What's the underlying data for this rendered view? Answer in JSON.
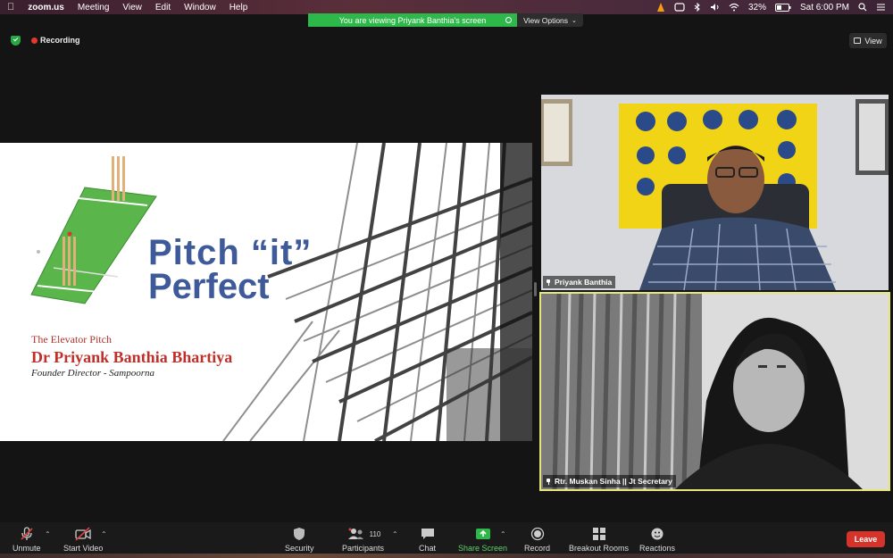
{
  "menubar": {
    "app_name": "zoom.us",
    "items": [
      "Meeting",
      "View",
      "Edit",
      "Window",
      "Help"
    ],
    "battery": "32%",
    "clock": "Sat 6:00 PM"
  },
  "share_banner": {
    "text": "You are viewing Priyank Banthia's screen",
    "view_options_label": "View Options"
  },
  "status": {
    "recording_label": "Recording",
    "view_label": "View"
  },
  "slide": {
    "title_line1": "Pitch “it”",
    "title_line2": "Perfect",
    "subtitle": "The Elevator Pitch",
    "presenter_name": "Dr Priyank Banthia Bhartiya",
    "presenter_role": "Founder Director - Sampoorna"
  },
  "participants_video": [
    {
      "name": "Priyank Banthia"
    },
    {
      "name": "Rtr. Muskan Sinha || Jt Secretary"
    }
  ],
  "toolbar": {
    "unmute": "Unmute",
    "start_video": "Start Video",
    "security": "Security",
    "participants": "Participants",
    "participants_count": "110",
    "chat": "Chat",
    "share_screen": "Share Screen",
    "record": "Record",
    "breakout_rooms": "Breakout Rooms",
    "reactions": "Reactions",
    "leave": "Leave"
  },
  "colors": {
    "share_green": "#2fb84a",
    "leave_red": "#d6342b",
    "title_blue": "#3e5a9a",
    "presenter_red": "#c0302a",
    "active_speaker_border": "#e6e67a"
  }
}
